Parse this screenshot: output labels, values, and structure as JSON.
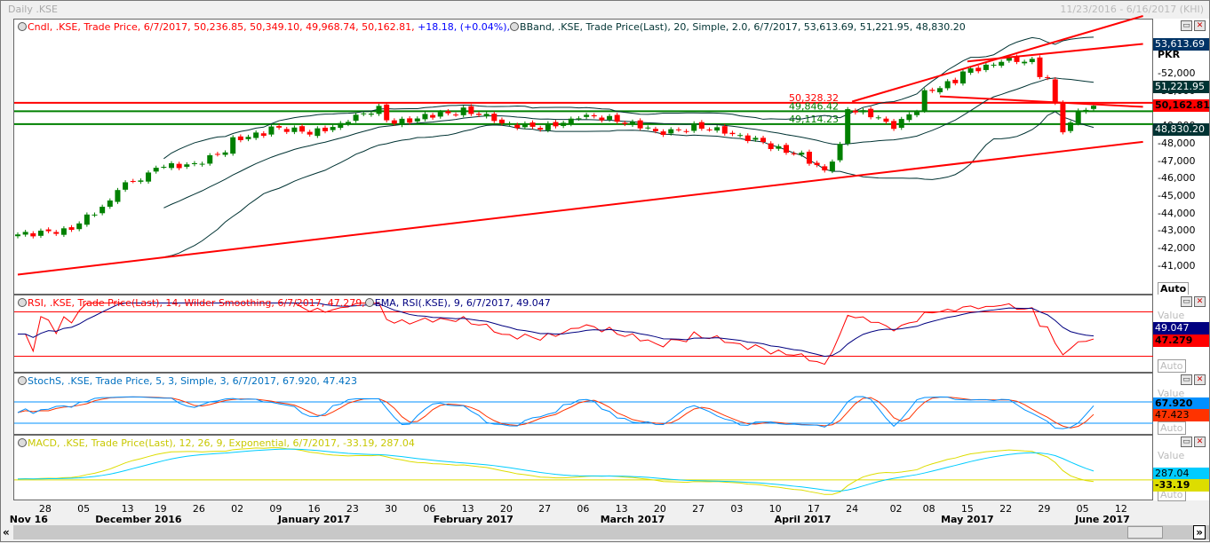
{
  "window": {
    "title": "Daily .KSE",
    "range": "11/23/2016 - 6/16/2017 (KHI)"
  },
  "main": {
    "legend_candle": "Cndl, .KSE, Trade Price, 6/7/2017, 50,236.85, 50,349.10, 49,968.74, 50,162.81,",
    "legend_change": "+18.18, (+0.04%),",
    "legend_bband": "BBand, .KSE, Trade Price(Last), 20, Simple, 2.0, 6/7/2017, 53,613.69, 51,221.95, 48,830.20",
    "currency": "PKR",
    "auto": "Auto",
    "tags": {
      "upper": "53,613.69",
      "mid": "51,221.95",
      "last": "50,162.81",
      "lower": "48,830.20"
    },
    "hlines": [
      {
        "value": 50328.32,
        "label": "50,328.32",
        "color": "#ff0000"
      },
      {
        "value": 49846.42,
        "label": "49,846.42",
        "color": "#008000"
      },
      {
        "value": 49114.23,
        "label": "49,114.23",
        "color": "#008000"
      }
    ]
  },
  "rsi": {
    "legend_rsi": "RSI, .KSE, Trade Price(Last), 14, Wilder Smoothing, 6/7/2017, 47.279,",
    "legend_ema": "EMA, RSI(.KSE), 9, 6/7/2017, 49.047",
    "value_label": "Value",
    "ema_tag": "49.047",
    "rsi_tag": "47.279",
    "auto": "Auto"
  },
  "stoch": {
    "legend": "StochS, .KSE, Trade Price, 5, 3, Simple, 3, 6/7/2017, 67.920, 47.423",
    "value_label": "Value",
    "k_tag": "67.920",
    "d_tag": "47.423",
    "auto": "Auto"
  },
  "macd": {
    "legend": "MACD, .KSE, Trade Price(Last), 12, 26, 9, Exponential, 6/7/2017, -33.19, 287.04",
    "value_label": "Value",
    "macd_tag": "287.04",
    "signal_tag": "-33.19",
    "auto": "Auto"
  },
  "colors": {
    "up": "#008000",
    "down": "#ff0000",
    "band": "#003333"
  },
  "chart_data": {
    "type": "candlestick",
    "start": "2016-11-23",
    "end": "2017-06-07",
    "yticks": [
      52000,
      51000,
      50000,
      49000,
      48000,
      47000,
      46000,
      45000,
      44000,
      43000,
      42000,
      41000
    ],
    "ytick_labels": [
      "52,000",
      "51,000",
      "50,000",
      "49,000",
      "48,000",
      "47,000",
      "46,000",
      "45,000",
      "44,000",
      "43,000",
      "42,000",
      "41,000"
    ],
    "price_points": [
      [
        "2016-11-23",
        42800
      ],
      [
        "2016-12-01",
        43000
      ],
      [
        "2016-12-05",
        43500
      ],
      [
        "2016-12-12",
        45500
      ],
      [
        "2016-12-19",
        46700
      ],
      [
        "2016-12-26",
        46800
      ],
      [
        "2017-01-02",
        48200
      ],
      [
        "2017-01-09",
        48900
      ],
      [
        "2017-01-16",
        48600
      ],
      [
        "2017-01-23",
        49400
      ],
      [
        "2017-01-27",
        50000
      ],
      [
        "2017-01-31",
        49200
      ],
      [
        "2017-02-06",
        49600
      ],
      [
        "2017-02-13",
        49900
      ],
      [
        "2017-02-20",
        49100
      ],
      [
        "2017-02-27",
        48900
      ],
      [
        "2017-03-06",
        49600
      ],
      [
        "2017-03-13",
        49300
      ],
      [
        "2017-03-20",
        48600
      ],
      [
        "2017-03-27",
        49000
      ],
      [
        "2017-04-03",
        48500
      ],
      [
        "2017-04-10",
        47800
      ],
      [
        "2017-04-17",
        47000
      ],
      [
        "2017-04-19",
        46400
      ],
      [
        "2017-04-24",
        50000
      ],
      [
        "2017-05-02",
        49000
      ],
      [
        "2017-05-08",
        50900
      ],
      [
        "2017-05-15",
        52100
      ],
      [
        "2017-05-22",
        52800
      ],
      [
        "2017-05-26",
        52700
      ],
      [
        "2017-05-30",
        51700
      ],
      [
        "2017-06-01",
        48800
      ],
      [
        "2017-06-05",
        49900
      ],
      [
        "2017-06-07",
        50163
      ]
    ],
    "trendlines": [
      [
        [
          "2016-11-23",
          40500
        ],
        [
          "2017-06-16",
          48100
        ]
      ],
      [
        [
          "2017-04-24",
          50400
        ],
        [
          "2017-06-16",
          55300
        ]
      ],
      [
        [
          "2017-05-15",
          52700
        ],
        [
          "2017-06-16",
          53700
        ]
      ],
      [
        [
          "2017-05-10",
          50700
        ],
        [
          "2017-06-16",
          50100
        ]
      ]
    ],
    "xticks": [
      [
        "28",
        "2016-11-28"
      ],
      [
        "05",
        "2016-12-05"
      ],
      [
        "13",
        "2016-12-13"
      ],
      [
        "19",
        "2016-12-19"
      ],
      [
        "26",
        "2016-12-26"
      ],
      [
        "02",
        "2017-01-02"
      ],
      [
        "09",
        "2017-01-09"
      ],
      [
        "16",
        "2017-01-16"
      ],
      [
        "23",
        "2017-01-23"
      ],
      [
        "30",
        "2017-01-30"
      ],
      [
        "06",
        "2017-02-06"
      ],
      [
        "13",
        "2017-02-13"
      ],
      [
        "20",
        "2017-02-20"
      ],
      [
        "27",
        "2017-02-27"
      ],
      [
        "06",
        "2017-03-06"
      ],
      [
        "13",
        "2017-03-13"
      ],
      [
        "20",
        "2017-03-20"
      ],
      [
        "27",
        "2017-03-27"
      ],
      [
        "03",
        "2017-04-03"
      ],
      [
        "10",
        "2017-04-10"
      ],
      [
        "17",
        "2017-04-17"
      ],
      [
        "24",
        "2017-04-24"
      ],
      [
        "02",
        "2017-05-02"
      ],
      [
        "08",
        "2017-05-08"
      ],
      [
        "15",
        "2017-05-15"
      ],
      [
        "22",
        "2017-05-22"
      ],
      [
        "29",
        "2017-05-29"
      ],
      [
        "05",
        "2017-06-05"
      ],
      [
        "12",
        "2017-06-12"
      ]
    ],
    "months": [
      [
        "Nov 16",
        "2016-11-25"
      ],
      [
        "December 2016",
        "2016-12-15"
      ],
      [
        "January 2017",
        "2017-01-16"
      ],
      [
        "February 2017",
        "2017-02-14"
      ],
      [
        "March 2017",
        "2017-03-15"
      ],
      [
        "April 2017",
        "2017-04-15"
      ],
      [
        "May 2017",
        "2017-05-15"
      ],
      [
        "June 2017",
        "2017-06-10"
      ]
    ]
  }
}
